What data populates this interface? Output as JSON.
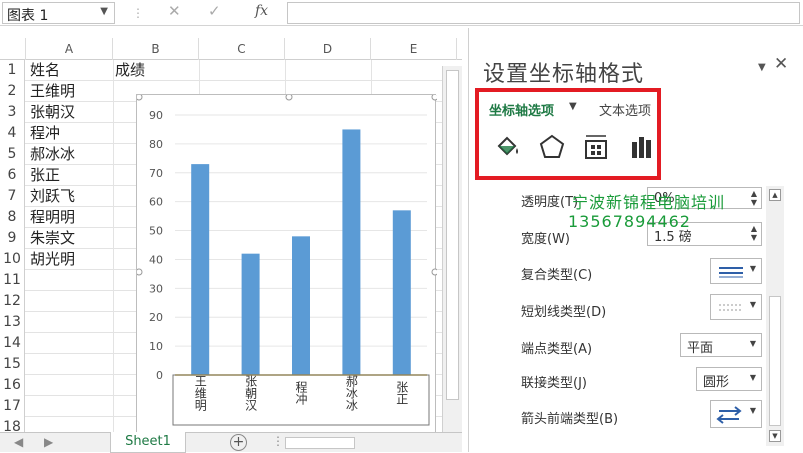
{
  "formula_bar": {
    "name_box": "图表 1",
    "cancel_icon": "close-icon",
    "enter_icon": "check-icon",
    "function_label": "fx",
    "formula_value": ""
  },
  "sheet": {
    "columns": [
      "A",
      "B",
      "C",
      "D",
      "E"
    ],
    "rows": [
      {
        "num": "1",
        "a": "姓名",
        "b": "成绩"
      },
      {
        "num": "2",
        "a": "王维明",
        "b": ""
      },
      {
        "num": "3",
        "a": "张朝汉",
        "b": ""
      },
      {
        "num": "4",
        "a": "程冲",
        "b": ""
      },
      {
        "num": "5",
        "a": "郝冰冰",
        "b": ""
      },
      {
        "num": "6",
        "a": "张正",
        "b": ""
      },
      {
        "num": "7",
        "a": "刘跃飞",
        "b": ""
      },
      {
        "num": "8",
        "a": "程明明",
        "b": ""
      },
      {
        "num": "9",
        "a": "朱崇文",
        "b": ""
      },
      {
        "num": "10",
        "a": "胡光明",
        "b": ""
      },
      {
        "num": "11",
        "a": "",
        "b": ""
      },
      {
        "num": "12",
        "a": "",
        "b": ""
      },
      {
        "num": "13",
        "a": "",
        "b": ""
      },
      {
        "num": "14",
        "a": "",
        "b": ""
      },
      {
        "num": "15",
        "a": "",
        "b": ""
      },
      {
        "num": "16",
        "a": "",
        "b": ""
      },
      {
        "num": "17",
        "a": "",
        "b": ""
      },
      {
        "num": "18",
        "a": "",
        "b": ""
      }
    ],
    "tab_name": "Sheet1",
    "bar_color": "#5b9bd5"
  },
  "chart_data": {
    "type": "bar",
    "categories": [
      "王维明",
      "张朝汉",
      "程冲",
      "郝冰冰",
      "张正"
    ],
    "values": [
      73,
      42,
      48,
      85,
      57
    ],
    "yticks": [
      "0",
      "10",
      "20",
      "30",
      "40",
      "50",
      "60",
      "70",
      "80",
      "90"
    ],
    "ylim": [
      0,
      90
    ]
  },
  "pane": {
    "title": "设置坐标轴格式",
    "tab_axis_options": "坐标轴选项",
    "tab_text_options": "文本选项",
    "accent_color": "#1f7a45",
    "highlight_color": "#e31b23",
    "icons": [
      "fill-line-icon",
      "effects-pentagon-icon",
      "size-properties-icon",
      "axis-options-bar-icon"
    ],
    "properties": [
      {
        "label": "透明度(T)",
        "value": "0%",
        "control": "spin"
      },
      {
        "label": "宽度(W)",
        "value": "1.5 磅",
        "control": "spin"
      },
      {
        "label": "复合类型(C)",
        "value": "",
        "control": "icon-dropdown"
      },
      {
        "label": "短划线类型(D)",
        "value": "",
        "control": "icon-dropdown"
      },
      {
        "label": "端点类型(A)",
        "value": "平面",
        "control": "dropdown"
      },
      {
        "label": "联接类型(J)",
        "value": "圆形",
        "control": "dropdown"
      },
      {
        "label": "箭头前端类型(B)",
        "value": "",
        "control": "icon-dropdown"
      }
    ]
  },
  "watermark": {
    "line1": "宁波新锦程电脑培训",
    "line2": "13567894462"
  }
}
